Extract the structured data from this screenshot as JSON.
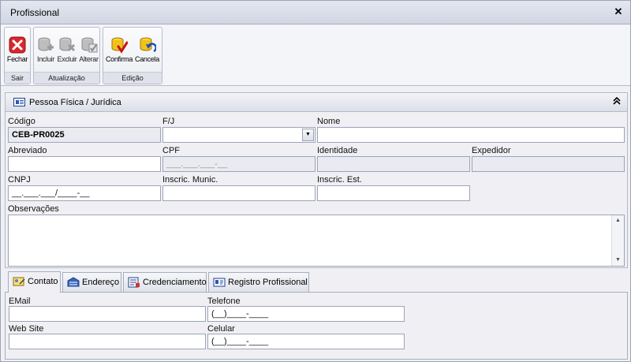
{
  "window": {
    "title": "Profissional",
    "close_glyph": "✕"
  },
  "ribbon": {
    "groups": [
      {
        "label": "Sair",
        "buttons": [
          {
            "label": "Fechar",
            "icon": "close-red-icon"
          }
        ]
      },
      {
        "label": "Atualização",
        "buttons": [
          {
            "label": "Incluir",
            "icon": "db-add-icon"
          },
          {
            "label": "Excluir",
            "icon": "db-delete-icon"
          },
          {
            "label": "Alterar",
            "icon": "db-edit-icon"
          }
        ]
      },
      {
        "label": "Edição",
        "buttons": [
          {
            "label": "Confirma",
            "icon": "db-confirm-icon"
          },
          {
            "label": "Cancela",
            "icon": "db-cancel-icon"
          }
        ]
      }
    ]
  },
  "panel": {
    "title": "Pessoa Física / Jurídica",
    "collapse_glyph": "⌃",
    "fields": {
      "codigo": {
        "label": "Código",
        "value": "CEB-PR0025"
      },
      "fj": {
        "label": "F/J",
        "value": ""
      },
      "nome": {
        "label": "Nome",
        "value": ""
      },
      "abreviado": {
        "label": "Abreviado",
        "value": ""
      },
      "cpf": {
        "label": "CPF",
        "value": "___.___.___-__"
      },
      "identidade": {
        "label": "Identidade",
        "value": ""
      },
      "expedidor": {
        "label": "Expedidor",
        "value": ""
      },
      "cnpj": {
        "label": "CNPJ",
        "value": "__.___.___/____-__"
      },
      "inscric_munic": {
        "label": "Inscric. Munic.",
        "value": ""
      },
      "inscric_est": {
        "label": "Inscric. Est.",
        "value": ""
      },
      "observacoes": {
        "label": "Observações",
        "value": ""
      }
    }
  },
  "tabs": [
    {
      "label": "Contato",
      "icon": "contact-icon",
      "active": true
    },
    {
      "label": "Endereço",
      "icon": "address-icon",
      "active": false
    },
    {
      "label": "Credenciamento",
      "icon": "credential-icon",
      "active": false
    },
    {
      "label": "Registro Profissional",
      "icon": "id-card-icon",
      "active": false
    }
  ],
  "contato": {
    "email": {
      "label": "EMail",
      "value": ""
    },
    "telefone": {
      "label": "Telefone",
      "value": "(__)____-____"
    },
    "website": {
      "label": "Web Site",
      "value": ""
    },
    "celular": {
      "label": "Celular",
      "value": "(__)____-____"
    }
  }
}
